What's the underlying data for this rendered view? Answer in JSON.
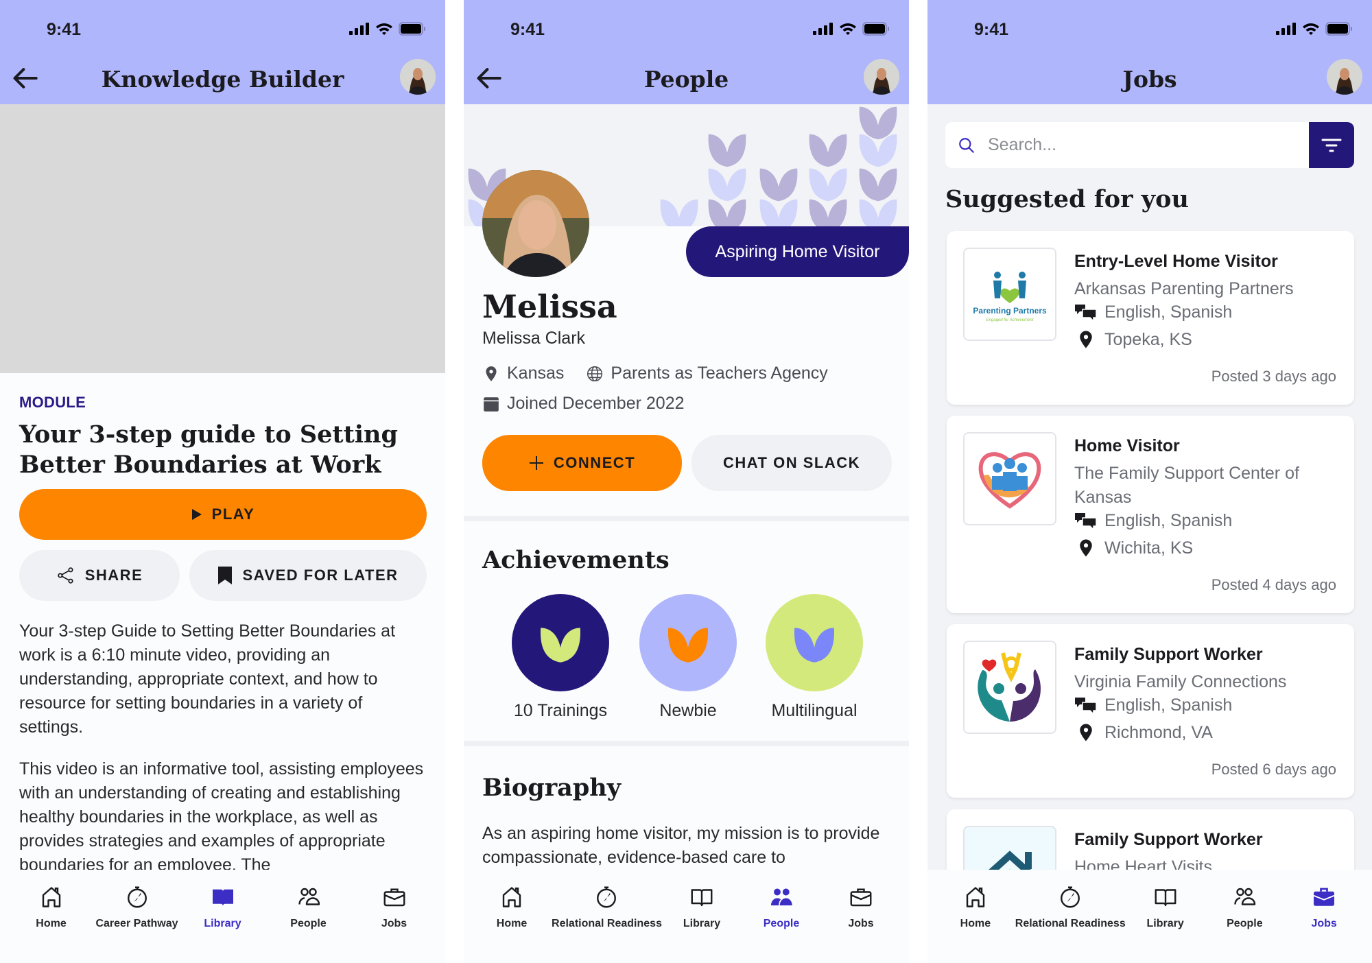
{
  "status_bar": {
    "time": "9:41"
  },
  "colors": {
    "header": "#b0b6fc",
    "accent_dark": "#24177a",
    "orange": "#fd8500",
    "nav_active": "#3c2dc5",
    "lime": "#d4e97b"
  },
  "screen1": {
    "header_title": "Knowledge Builder",
    "module_label": "MODULE",
    "module_title": "Your 3-step guide to Setting Better Boundaries at Work",
    "play_label": "PLAY",
    "share_label": "SHARE",
    "saved_label": "SAVED FOR LATER",
    "description": [
      "Your 3-step Guide to Setting Better Boundaries at work is a 6:10 minute video, providing an understanding, appropriate context, and how to resource for setting boundaries in a variety of settings.",
      "This video is an informative tool, assisting employees with an understanding of creating and establishing healthy boundaries in the workplace, as well as provides strategies and examples of appropriate boundaries for an employee. The"
    ],
    "nav": [
      {
        "label": "Home",
        "icon": "home-icon"
      },
      {
        "label": "Career Pathway",
        "icon": "compass-icon"
      },
      {
        "label": "Library",
        "icon": "book-icon",
        "active": true
      },
      {
        "label": "People",
        "icon": "people-icon"
      },
      {
        "label": "Jobs",
        "icon": "briefcase-icon"
      }
    ]
  },
  "screen2": {
    "header_title": "People",
    "role": "Aspiring Home Visitor",
    "display_name": "Melissa",
    "full_name": "Melissa Clark",
    "location": "Kansas",
    "agency": "Parents as Teachers Agency",
    "joined": "Joined December 2022",
    "connect_label": "CONNECT",
    "slack_label": "CHAT ON SLACK",
    "achievements_title": "Achievements",
    "achievements": [
      {
        "label": "10 Trainings",
        "bg": "#24177a",
        "leaf": "#d4e97b"
      },
      {
        "label": "Newbie",
        "bg": "#b0b6fc",
        "leaf": "#fd8500"
      },
      {
        "label": "Multilingual",
        "bg": "#d4e97b",
        "leaf": "#7b86f8"
      }
    ],
    "biography_title": "Biography",
    "biography": "As an aspiring home visitor, my mission is to provide compassionate, evidence-based care to",
    "nav": [
      {
        "label": "Home",
        "icon": "home-icon"
      },
      {
        "label": "Relational Readiness",
        "icon": "compass-icon"
      },
      {
        "label": "Library",
        "icon": "book-icon"
      },
      {
        "label": "People",
        "icon": "people-icon",
        "active": true
      },
      {
        "label": "Jobs",
        "icon": "briefcase-icon"
      }
    ]
  },
  "screen3": {
    "header_title": "Jobs",
    "search_placeholder": "Search...",
    "section_title": "Suggested for you",
    "jobs": [
      {
        "title": "Entry-Level Home Visitor",
        "org": "Arkansas Parenting Partners",
        "languages": "English, Spanish",
        "location": "Topeka, KS",
        "posted": "Posted 3 days ago",
        "logo_text": "Parenting Partners",
        "logo_tagline": "Engaged for Achievement"
      },
      {
        "title": "Home Visitor",
        "org": "The Family Support Center of Kansas",
        "languages": "English, Spanish",
        "location": "Wichita, KS",
        "posted": "Posted 4 days ago"
      },
      {
        "title": "Family Support Worker",
        "org": "Virginia Family Connections",
        "languages": "English, Spanish",
        "location": "Richmond, VA",
        "posted": "Posted 6 days ago"
      },
      {
        "title": "Family Support Worker",
        "org": "Home Heart Visits"
      }
    ],
    "nav": [
      {
        "label": "Home",
        "icon": "home-icon"
      },
      {
        "label": "Relational Readiness",
        "icon": "compass-icon"
      },
      {
        "label": "Library",
        "icon": "book-icon"
      },
      {
        "label": "People",
        "icon": "people-icon"
      },
      {
        "label": "Jobs",
        "icon": "briefcase-icon",
        "active": true
      }
    ]
  }
}
